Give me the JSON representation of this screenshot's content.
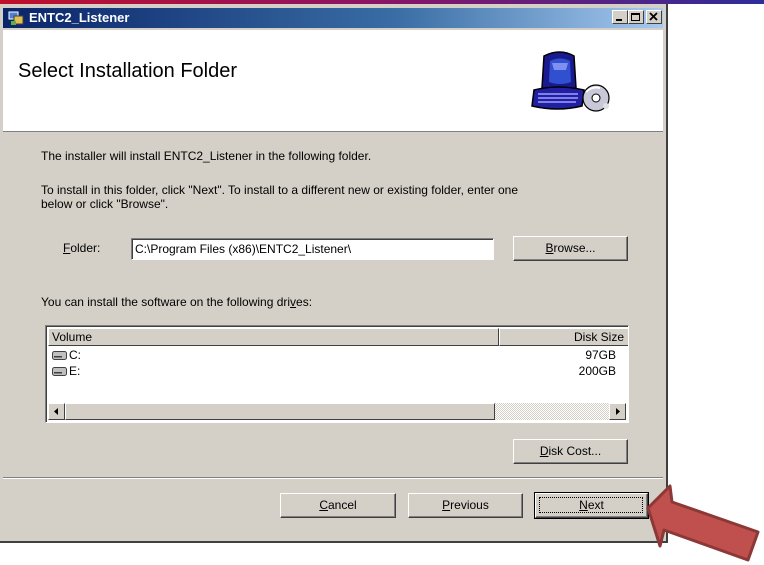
{
  "window": {
    "title": "ENTC2_Listener",
    "header_title": "Select Installation Folder"
  },
  "body": {
    "intro": "The installer will install ENTC2_Listener in the following folder.",
    "instruction_line1": "To install in this folder, click \"Next\". To install to a different new or existing folder, enter one",
    "instruction_line2": "below or click \"Browse\".",
    "folder_label_first": "F",
    "folder_label_rest": "older:",
    "folder_value": "C:\\Program Files (x86)\\ENTC2_Listener\\",
    "browse_first": "B",
    "browse_rest": "rowse...",
    "drives_intro_pre": "You can install the software on the following dri",
    "drives_intro_u": "v",
    "drives_intro_post": "es:"
  },
  "drives_table": {
    "columns": [
      "Volume",
      "Disk Size"
    ],
    "rows": [
      {
        "volume": "C:",
        "size": "97GB"
      },
      {
        "volume": "E:",
        "size": "200GB"
      }
    ]
  },
  "buttons": {
    "disk_cost_first": "D",
    "disk_cost_rest": "isk Cost...",
    "cancel_first": "C",
    "cancel_rest": "ancel",
    "previous_first": "P",
    "previous_rest": "revious",
    "next_first": "N",
    "next_rest": "ext"
  },
  "icons": {
    "title_icon": "installer-icon",
    "header_icon": "computer-cd-icon",
    "drive_icon": "hard-drive-icon",
    "pointer": "red-arrow-icon"
  },
  "colors": {
    "titlebar_start": "#0a246a",
    "titlebar_end": "#a6caf0",
    "dialog_face": "#d4d0c8",
    "arrow_fill": "#c0504d"
  }
}
